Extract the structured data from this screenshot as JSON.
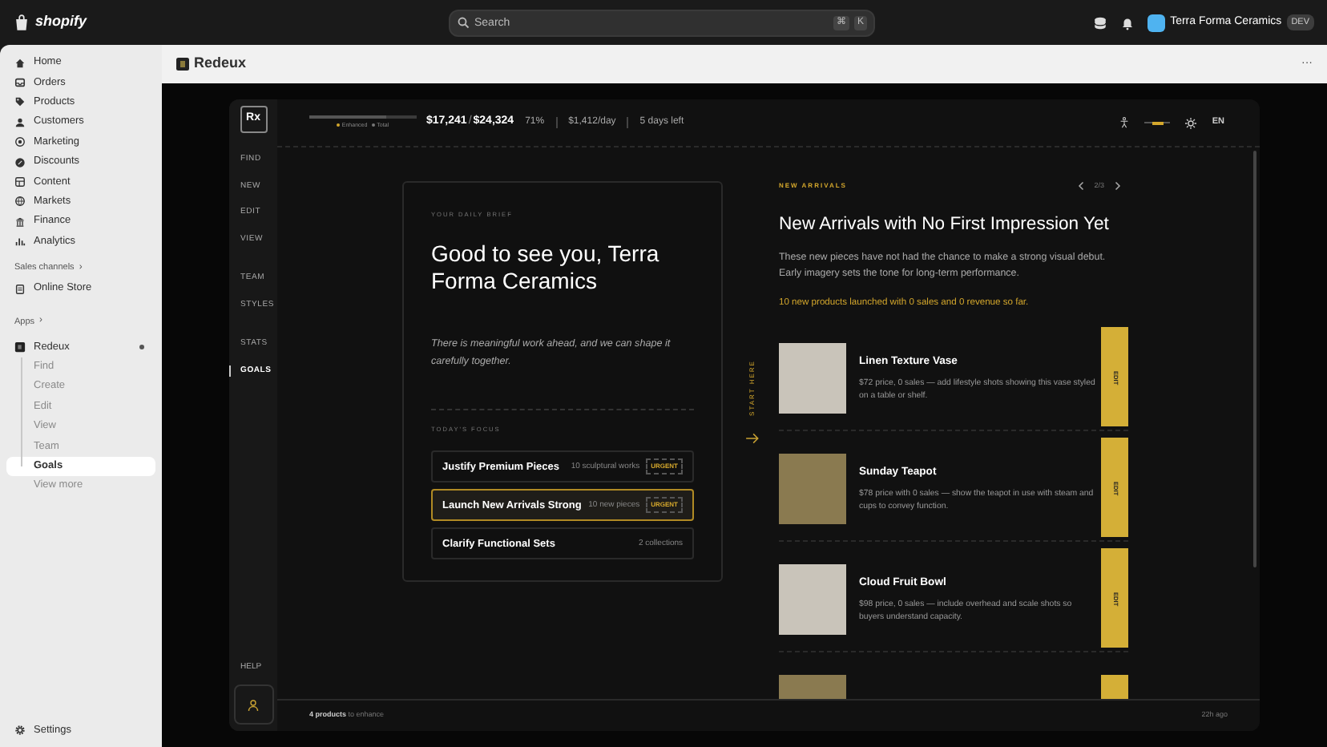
{
  "topbar": {
    "brand": "shopify",
    "search": {
      "placeholder": "Search",
      "shortcut": [
        "⌘",
        "K"
      ]
    },
    "store": "Terra Forma Ceramics",
    "store_badge": "DEV"
  },
  "sidebar": {
    "items": [
      {
        "label": "Home",
        "selected": false
      },
      {
        "label": "Orders",
        "selected": false
      },
      {
        "label": "Products",
        "selected": false
      },
      {
        "label": "Customers",
        "selected": false
      },
      {
        "label": "Marketing",
        "selected": false
      },
      {
        "label": "Discounts",
        "selected": false
      },
      {
        "label": "Content",
        "selected": false
      },
      {
        "label": "Markets",
        "selected": false
      },
      {
        "label": "Finance",
        "selected": false
      },
      {
        "label": "Analytics",
        "selected": false
      }
    ],
    "sales_channels": {
      "label": "Sales channels",
      "arrow": "›",
      "items": [
        {
          "label": "Online Store"
        }
      ]
    },
    "apps": {
      "label": "Apps",
      "arrow": "›",
      "app": {
        "label": "Redeux",
        "expanded": true,
        "children": [
          {
            "label": "Find",
            "selected": false
          },
          {
            "label": "Create",
            "selected": false
          },
          {
            "label": "Edit",
            "selected": false
          },
          {
            "label": "View",
            "selected": false
          },
          {
            "label": "Team",
            "selected": false
          },
          {
            "label": "Goals",
            "selected": true
          }
        ],
        "more": "View more"
      }
    },
    "settings": "Settings"
  },
  "page_header": {
    "title": "Redeux",
    "more": "···"
  },
  "app": {
    "logo": "Rx",
    "nav_groups": [
      [
        {
          "label": "FIND",
          "selected": false
        },
        {
          "label": "NEW",
          "selected": false
        },
        {
          "label": "EDIT",
          "selected": false
        },
        {
          "label": "VIEW",
          "selected": false
        }
      ],
      [
        {
          "label": "TEAM",
          "selected": false
        },
        {
          "label": "STYLES",
          "selected": false
        }
      ],
      [
        {
          "label": "STATS",
          "selected": false
        },
        {
          "label": "GOALS",
          "selected": true
        }
      ]
    ],
    "help": "HELP",
    "progress": {
      "level": 0.71,
      "legend": [
        "Enhanced",
        "Total"
      ],
      "amount": "$17,241",
      "separator": "/",
      "total": "$24,324",
      "percent": "71%",
      "rate": "$1,412/day",
      "days_left": "5 days left"
    },
    "toolbar": {
      "contrast": {
        "level": 0.5
      },
      "language": "EN"
    },
    "brief": {
      "eyebrow": "YOUR DAILY BRIEF",
      "greeting": "Good to see you, Terra Forma Ceramics",
      "message": "There is meaningful work ahead, and we can shape it carefully together.",
      "focus_label": "TODAY'S FOCUS",
      "focus": [
        {
          "title": "Justify Premium Pieces",
          "detail": "10 sculptural works",
          "badge": "URGENT",
          "selected": false
        },
        {
          "title": "Launch New Arrivals Strong",
          "detail": "10 new pieces",
          "badge": "URGENT",
          "selected": true
        },
        {
          "title": "Clarify Functional Sets",
          "detail": "2 collections",
          "selected": false
        }
      ]
    },
    "start_here": "START HERE",
    "panel": {
      "eyebrow": "NEW ARRIVALS",
      "pager": "2/3",
      "title": "New Arrivals with No First Impression Yet",
      "description": "These new pieces have not had the chance to make a strong visual debut. Early imagery sets the tone for long-term performance.",
      "highlight": "10 new products launched with 0 sales and 0 revenue so far.",
      "products": [
        {
          "name": "Linen Texture Vase",
          "description": "$72 price, 0 sales — add lifestyle shots showing this vase styled on a table or shelf.",
          "action": "EDIT"
        },
        {
          "name": "Sunday Teapot",
          "description": "$78 price with 0 sales — show the teapot in use with steam and cups to convey function.",
          "action": "EDIT"
        },
        {
          "name": "Cloud Fruit Bowl",
          "description": "$98 price, 0 sales — include overhead and scale shots so buyers understand capacity.",
          "action": "EDIT"
        },
        {
          "kind": "cut_off"
        }
      ]
    },
    "footer": {
      "count": "4 products",
      "suffix": "to enhance",
      "updated": "22h ago"
    }
  }
}
